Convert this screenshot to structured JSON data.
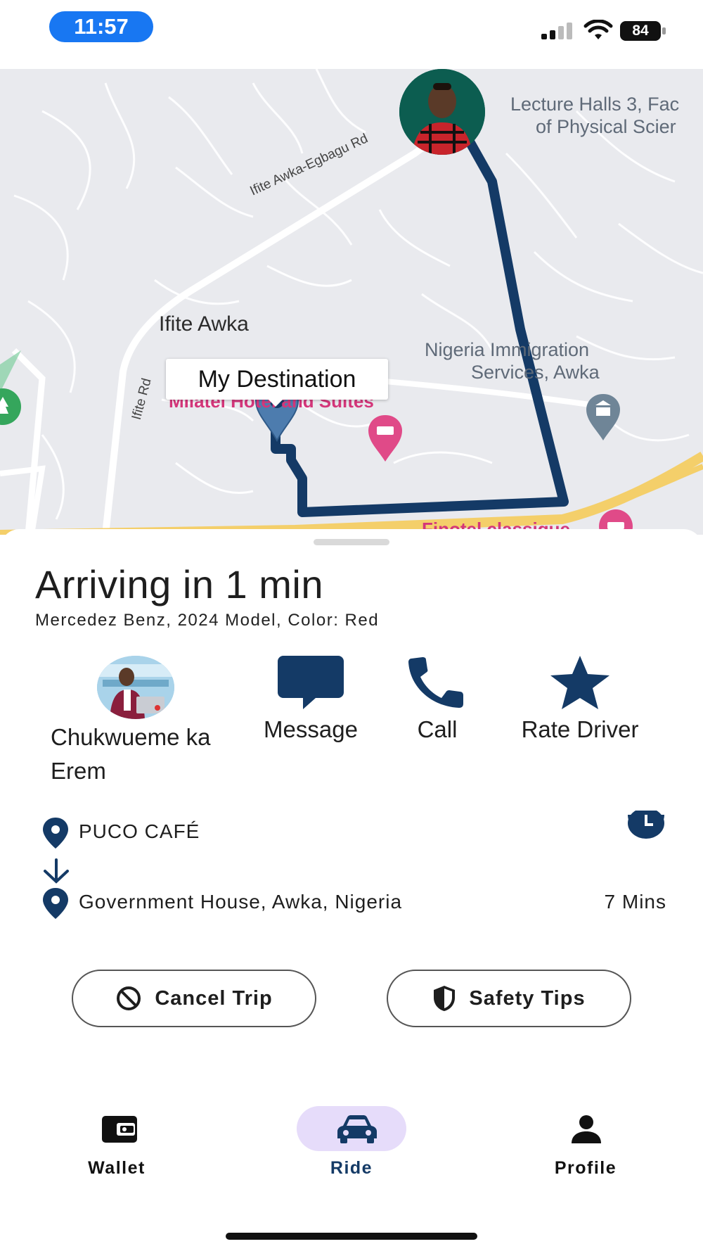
{
  "status_bar": {
    "time": "11:57",
    "battery": "84"
  },
  "map": {
    "labels": {
      "lecture_halls_line1": "Lecture Halls 3, Fac",
      "lecture_halls_line2": "of Physical Scier",
      "ifite_egbagu_road": "Ifite Awka-Egbagu Rd",
      "ifite_awka": "Ifite Awka",
      "ifite_rd": "Ifite Rd",
      "immigration_line1": "Nigeria Immigration",
      "immigration_line2": "Services, Awka",
      "hotel": "Milatel Hotel and Suites",
      "finotel": "Finotel classique"
    },
    "destination_tag": "My Destination",
    "route_color": "#143a66"
  },
  "trip": {
    "title": "Arriving in 1 min",
    "car_info": "Mercedez Benz, 2024 Model, Color: Red"
  },
  "actions": {
    "driver_name": "Chukwueme ka Erem",
    "message_label": "Message",
    "call_label": "Call",
    "rate_label": "Rate Driver"
  },
  "route": {
    "pickup": "PUCO CAFÉ",
    "dropoff": "Government House, Awka, Nigeria",
    "eta": "7 Mins"
  },
  "buttons": {
    "cancel_label": "Cancel Trip",
    "safety_label": "Safety Tips"
  },
  "nav": {
    "wallet_label": "Wallet",
    "ride_label": "Ride",
    "profile_label": "Profile",
    "active": "Ride"
  },
  "colors": {
    "accent": "#143a66",
    "status_pill": "#1877f2",
    "nav_active_bg": "#e6dcfa"
  }
}
